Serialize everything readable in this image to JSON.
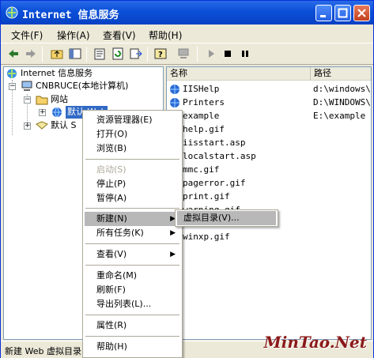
{
  "window": {
    "title": "Internet 信息服务"
  },
  "menubar": [
    {
      "label": "文件(F)"
    },
    {
      "label": "操作(A)"
    },
    {
      "label": "查看(V)"
    },
    {
      "label": "帮助(H)"
    }
  ],
  "tree": {
    "root": "Internet 信息服务",
    "computer": "CNBRUCE(本地计算机)",
    "websites": "网站",
    "default_site": "默认 Web",
    "default_smtp": "默认 S"
  },
  "list": {
    "columns": [
      "名称",
      "路径"
    ],
    "rows": [
      {
        "name": "IISHelp",
        "path": "d:\\windows\\h"
      },
      {
        "name": "Printers",
        "path": "D:\\WINDOWS\\w"
      },
      {
        "name": "example",
        "path": "E:\\example"
      },
      {
        "name": "help.gif",
        "path": ""
      },
      {
        "name": "iisstart.asp",
        "path": ""
      },
      {
        "name": "localstart.asp",
        "path": ""
      },
      {
        "name": "mmc.gif",
        "path": ""
      },
      {
        "name": "pagerror.gif",
        "path": ""
      },
      {
        "name": "print.gif",
        "path": ""
      },
      {
        "name": "warning.gif",
        "path": ""
      },
      {
        "name": "",
        "path": ""
      },
      {
        "name": "winxp.gif",
        "path": ""
      }
    ]
  },
  "context_menu": {
    "items": [
      {
        "label": "资源管理器(E)",
        "disabled": false
      },
      {
        "label": "打开(O)",
        "disabled": false
      },
      {
        "label": "浏览(B)",
        "disabled": false
      },
      {
        "label": "启动(S)",
        "disabled": true
      },
      {
        "label": "停止(P)",
        "disabled": false
      },
      {
        "label": "暂停(A)",
        "disabled": false
      },
      {
        "label": "新建(N)",
        "disabled": false,
        "submenu": true,
        "selected": true
      },
      {
        "label": "所有任务(K)",
        "disabled": false,
        "submenu": true
      },
      {
        "label": "查看(V)",
        "disabled": false,
        "submenu": true
      },
      {
        "label": "重命名(M)",
        "disabled": false
      },
      {
        "label": "刷新(F)",
        "disabled": false
      },
      {
        "label": "导出列表(L)...",
        "disabled": false
      },
      {
        "label": "属性(R)",
        "disabled": false
      },
      {
        "label": "帮助(H)",
        "disabled": false
      }
    ],
    "submenu": {
      "label": "虚拟目录(V)..."
    }
  },
  "statusbar": {
    "text": "新建 Web 虚拟目录"
  },
  "watermark": "MinTao.Net",
  "colors": {
    "titlebar": "#0a4fd8",
    "selection": "#b8b8b8",
    "window_bg": "#ece9d8"
  }
}
